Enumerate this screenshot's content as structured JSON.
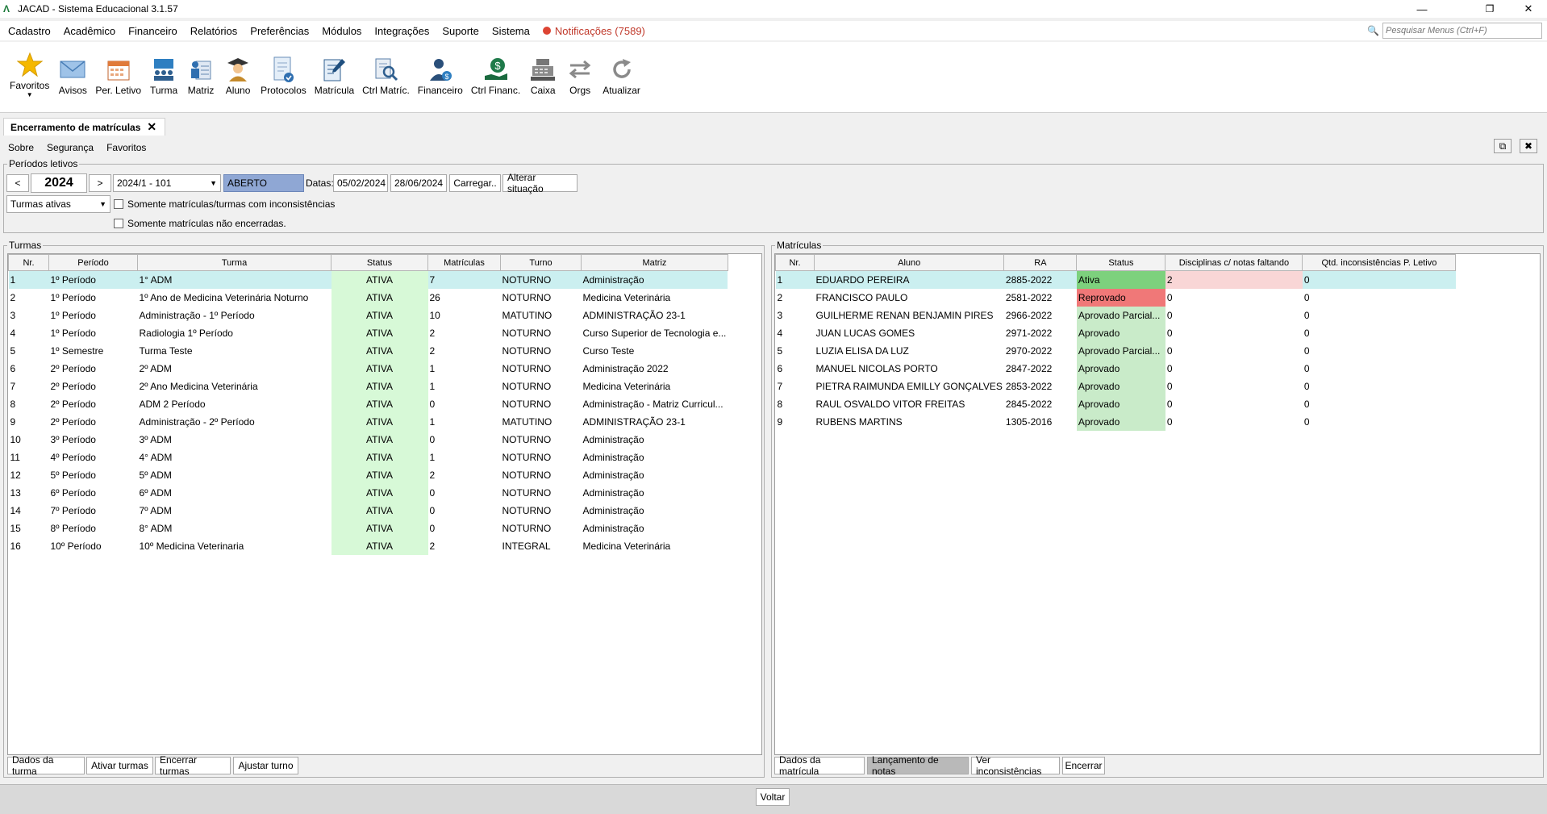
{
  "window": {
    "title": "JACAD - Sistema Educacional 3.1.57"
  },
  "menu": {
    "items": [
      "Cadastro",
      "Acadêmico",
      "Financeiro",
      "Relatórios",
      "Preferências",
      "Módulos",
      "Integrações",
      "Suporte",
      "Sistema"
    ],
    "notifications": "Notificações (7589)",
    "search_placeholder": "Pesquisar Menus (Ctrl+F)"
  },
  "toolbar": {
    "buttons": [
      "Favoritos",
      "Avisos",
      "Per. Letivo",
      "Turma",
      "Matriz",
      "Aluno",
      "Protocolos",
      "Matrícula",
      "Ctrl Matríc.",
      "Financeiro",
      "Ctrl Financ.",
      "Caixa",
      "Orgs",
      "Atualizar"
    ]
  },
  "doc_tab": {
    "title": "Encerramento de matrículas"
  },
  "submenu": [
    "Sobre",
    "Segurança",
    "Favoritos"
  ],
  "periodos": {
    "label": "Períodos letivos",
    "year": "2024",
    "periodo_select": "2024/1 - 101",
    "situacao": "ABERTO",
    "datas_label": "Datas:",
    "data_inicio": "05/02/2024",
    "data_fim": "28/06/2024",
    "carregar": "Carregar..",
    "alterar": "Alterar situação",
    "filter_select": "Turmas ativas",
    "chk1": "Somente matrículas/turmas com inconsistências",
    "chk2": "Somente matrículas não encerradas."
  },
  "turmas": {
    "label": "Turmas",
    "columns": [
      "Nr.",
      "Período",
      "Turma",
      "Status",
      "Matrículas",
      "Turno",
      "Matriz"
    ],
    "rows": [
      [
        "1",
        "1º Período",
        "1° ADM",
        "ATIVA",
        "7",
        "NOTURNO",
        "Administração"
      ],
      [
        "2",
        "1º Período",
        "1º Ano de Medicina Veterinária Noturno",
        "ATIVA",
        "26",
        "NOTURNO",
        "Medicina Veterinária"
      ],
      [
        "3",
        "1º Período",
        "Administração - 1º Período",
        "ATIVA",
        "10",
        "MATUTINO",
        "ADMINISTRAÇÃO 23-1"
      ],
      [
        "4",
        "1º Período",
        "Radiologia 1º Período",
        "ATIVA",
        "2",
        "NOTURNO",
        "Curso Superior de Tecnologia e..."
      ],
      [
        "5",
        "1º Semestre",
        "Turma Teste",
        "ATIVA",
        "2",
        "NOTURNO",
        "Curso Teste"
      ],
      [
        "6",
        "2º Período",
        "2º ADM",
        "ATIVA",
        "1",
        "NOTURNO",
        "Administração 2022"
      ],
      [
        "7",
        "2º Período",
        "2º Ano Medicina Veterinária",
        "ATIVA",
        "1",
        "NOTURNO",
        "Medicina Veterinária"
      ],
      [
        "8",
        "2º Período",
        "ADM 2 Período",
        "ATIVA",
        "0",
        "NOTURNO",
        "Administração - Matriz Curricul..."
      ],
      [
        "9",
        "2º Período",
        "Administração - 2º Período",
        "ATIVA",
        "1",
        "MATUTINO",
        "ADMINISTRAÇÃO 23-1"
      ],
      [
        "10",
        "3º Período",
        "3º ADM",
        "ATIVA",
        "0",
        "NOTURNO",
        "Administração"
      ],
      [
        "11",
        "4º Período",
        "4° ADM",
        "ATIVA",
        "1",
        "NOTURNO",
        "Administração"
      ],
      [
        "12",
        "5º Período",
        "5º ADM",
        "ATIVA",
        "2",
        "NOTURNO",
        "Administração"
      ],
      [
        "13",
        "6º Período",
        "6º ADM",
        "ATIVA",
        "0",
        "NOTURNO",
        "Administração"
      ],
      [
        "14",
        "7º Período",
        "7º ADM",
        "ATIVA",
        "0",
        "NOTURNO",
        "Administração"
      ],
      [
        "15",
        "8º Período",
        "8° ADM",
        "ATIVA",
        "0",
        "NOTURNO",
        "Administração"
      ],
      [
        "16",
        "10º Período",
        "10º  Medicina Veterinaria",
        "ATIVA",
        "2",
        "INTEGRAL",
        "Medicina Veterinária"
      ]
    ],
    "buttons": [
      "Dados da turma",
      "Ativar turmas",
      "Encerrar turmas",
      "Ajustar turno"
    ]
  },
  "matriculas": {
    "label": "Matrículas",
    "columns": [
      "Nr.",
      "Aluno",
      "RA",
      "Status",
      "Disciplinas c/ notas faltando",
      "Qtd. inconsistências P. Letivo"
    ],
    "rows": [
      [
        "1",
        "EDUARDO PEREIRA",
        "2885-2022",
        "Ativa",
        "2",
        "0"
      ],
      [
        "2",
        "FRANCISCO PAULO",
        "2581-2022",
        "Reprovado",
        "0",
        "0"
      ],
      [
        "3",
        "GUILHERME RENAN BENJAMIN PIRES",
        "2966-2022",
        "Aprovado Parcial...",
        "0",
        "0"
      ],
      [
        "4",
        "JUAN LUCAS GOMES",
        "2971-2022",
        "Aprovado",
        "0",
        "0"
      ],
      [
        "5",
        "LUZIA ELISA DA LUZ",
        "2970-2022",
        "Aprovado Parcial...",
        "0",
        "0"
      ],
      [
        "6",
        "MANUEL NICOLAS PORTO",
        "2847-2022",
        "Aprovado",
        "0",
        "0"
      ],
      [
        "7",
        "PIETRA RAIMUNDA EMILLY GONÇALVES",
        "2853-2022",
        "Aprovado",
        "0",
        "0"
      ],
      [
        "8",
        "RAUL OSVALDO VITOR FREITAS",
        "2845-2022",
        "Aprovado",
        "0",
        "0"
      ],
      [
        "9",
        "RUBENS MARTINS",
        "1305-2016",
        "Aprovado",
        "0",
        "0"
      ]
    ],
    "buttons": [
      "Dados da matrícula",
      "Lançamento de notas",
      "Ver inconsistências",
      "Encerrar"
    ]
  },
  "footer": {
    "voltar": "Voltar"
  },
  "colors": {
    "selected_row": "#cbeff0",
    "status_green": "#d7f9d7",
    "ativa": "#7dd17d",
    "reprovado": "#f07878",
    "aprovado": "#c9ebc9",
    "pending_notes": "#f9d6d6"
  }
}
